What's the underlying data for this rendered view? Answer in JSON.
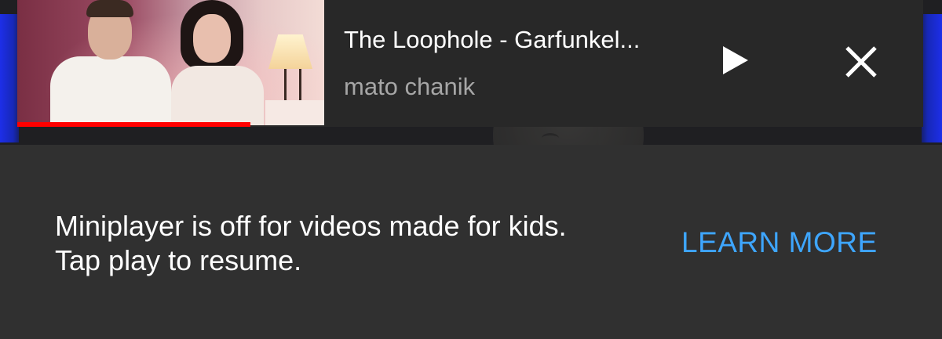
{
  "miniplayer": {
    "title": "The Loophole - Garfunkel...",
    "channel": "mato chanik",
    "progress": 0.76,
    "progress_color": "#ff0000",
    "play_icon": "play-icon",
    "close_icon": "close-icon"
  },
  "snackbar": {
    "message_line1": "Miniplayer is off for videos made for kids.",
    "message_line2": "Tap play to resume.",
    "action_label": "LEARN MORE",
    "action_color": "#3ea6ff"
  }
}
